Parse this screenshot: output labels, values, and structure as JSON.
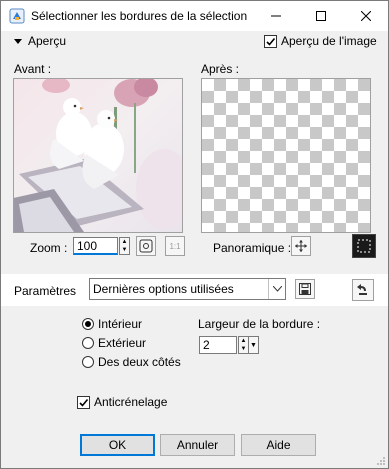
{
  "window": {
    "title": "Sélectionner les bordures de la sélection"
  },
  "preview": {
    "section_label": "Aperçu",
    "image_preview_label": "Aperçu de l'image",
    "image_preview_checked": true,
    "before_label": "Avant :",
    "after_label": "Après :"
  },
  "zoom": {
    "label": "Zoom :",
    "value": "100",
    "onetoone_label": "1:1"
  },
  "pan": {
    "label": "Panoramique :"
  },
  "params": {
    "label": "Paramètres",
    "preset": "Dernières options utilisées"
  },
  "options": {
    "radios": [
      {
        "label": "Intérieur",
        "selected": true
      },
      {
        "label": "Extérieur",
        "selected": false
      },
      {
        "label": "Des deux côtés",
        "selected": false
      }
    ],
    "border_width_label": "Largeur de la bordure :",
    "border_width_value": "2",
    "antialias_label": "Anticrénelage",
    "antialias_checked": true
  },
  "buttons": {
    "ok": "OK",
    "cancel": "Annuler",
    "help": "Aide"
  },
  "colors": {
    "accent": "#0078d7",
    "checker": "#c8c8c8"
  }
}
